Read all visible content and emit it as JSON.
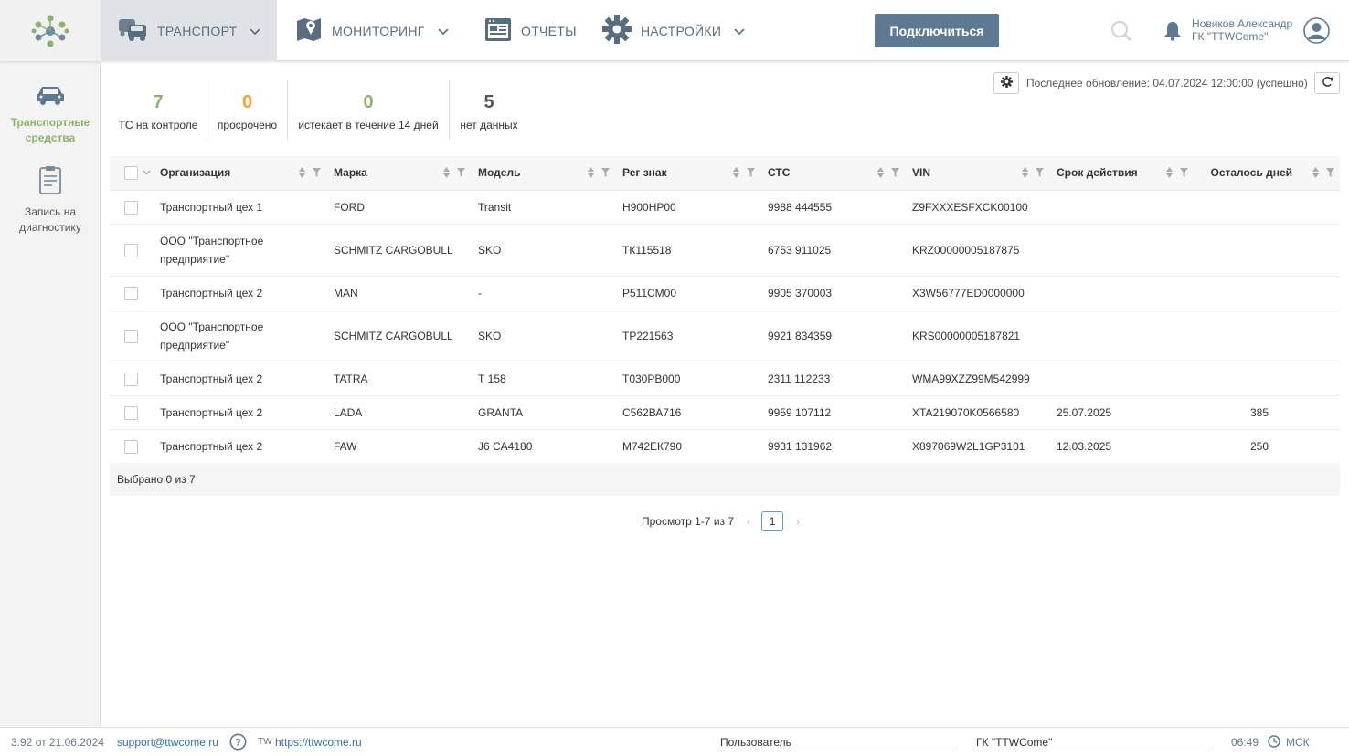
{
  "nav": {
    "items": [
      {
        "label": "ТРАНСПОРТ",
        "icon": "truck-car-icon",
        "active": true,
        "has_chevron": true
      },
      {
        "label": "МОНИТОРИНГ",
        "icon": "map-pin-icon",
        "active": false,
        "has_chevron": true
      },
      {
        "label": "ОТЧЕТЫ",
        "icon": "report-icon",
        "active": false,
        "has_chevron": false
      },
      {
        "label": "НАСТРОЙКИ",
        "icon": "gear-icon",
        "active": false,
        "has_chevron": true
      }
    ],
    "connect_label": "Подключиться",
    "user_name": "Новиков Александр",
    "user_org": "ГК \"TTWCome\""
  },
  "sidebar": {
    "items": [
      {
        "label1": "Транспортные",
        "label2": "средства",
        "active": true
      },
      {
        "label1": "Запись на",
        "label2": "диагностику",
        "active": false
      }
    ]
  },
  "stats": [
    {
      "value": "7",
      "caption": "ТС на контроле",
      "color": "#8bb36b"
    },
    {
      "value": "0",
      "caption": "просрочено",
      "color": "#f0a030"
    },
    {
      "value": "0",
      "caption": "истекает в течение 14 дней",
      "color": "#8bb36b"
    },
    {
      "value": "5",
      "caption": "нет данных",
      "color": "#555555"
    }
  ],
  "update": {
    "text": "Последнее обновление: 04.07.2024 12:00:00 (успешно)"
  },
  "table": {
    "columns": [
      "Организация",
      "Марка",
      "Модель",
      "Рег знак",
      "СТС",
      "VIN",
      "Срок действия",
      "Осталось дней"
    ],
    "rows": [
      {
        "org": "Транспортный цех 1",
        "brand": "FORD",
        "model": "Transit",
        "reg": "Н900НР00",
        "sts": "9988 444555",
        "vin": "Z9FXXXESFXCK00100",
        "exp": "",
        "days": ""
      },
      {
        "org": "ООО \"Транспортное предприятие\"",
        "brand": "SCHMITZ CARGOBULL",
        "model": "SKO",
        "reg": "ТК115518",
        "sts": "6753 911025",
        "vin": "KRZ00000005187875",
        "exp": "",
        "days": ""
      },
      {
        "org": "Транспортный цех 2",
        "brand": "MAN",
        "model": "-",
        "reg": "Р511СМ00",
        "sts": "9905 370003",
        "vin": "X3W56777ED0000000",
        "exp": "",
        "days": ""
      },
      {
        "org": "ООО \"Транспортное предприятие\"",
        "brand": "SCHMITZ CARGOBULL",
        "model": "SKO",
        "reg": "ТР221563",
        "sts": "9921 834359",
        "vin": "KRS00000005187821",
        "exp": "",
        "days": ""
      },
      {
        "org": "Транспортный цех 2",
        "brand": "TATRA",
        "model": "Т 158",
        "reg": "Т030РВ000",
        "sts": "2311 112233",
        "vin": "WMA99XZZ99M542999",
        "exp": "",
        "days": ""
      },
      {
        "org": "Транспортный цех 2",
        "brand": "LADA",
        "model": "GRANTA",
        "reg": "С562ВА716",
        "sts": "9959 107112",
        "vin": "XTA219070K0566580",
        "exp": "25.07.2025",
        "days": "385"
      },
      {
        "org": "Транспортный цех 2",
        "brand": "FAW",
        "model": "J6 CA4180",
        "reg": "М742ЕК790",
        "sts": "9931 131962",
        "vin": "X897069W2L1GP3101",
        "exp": "12.03.2025",
        "days": "250"
      }
    ],
    "selected_text": "Выбрано 0 из 7"
  },
  "pager": {
    "text": "Просмотр 1-7 из 7",
    "current_page": "1"
  },
  "footer": {
    "version": "3.92 от 21.06.2024",
    "support": "support@ttwcome.ru",
    "tw": "TW",
    "site": "https://ttwcome.ru",
    "user_field": "Пользователь",
    "org_field": "ГК \"TTWCome\"",
    "time": "06:49",
    "tz": "МСК"
  },
  "colors": {
    "accent": "#5e7a93",
    "green": "#8bb36b",
    "orange": "#f0a030",
    "link": "#3070b0"
  }
}
